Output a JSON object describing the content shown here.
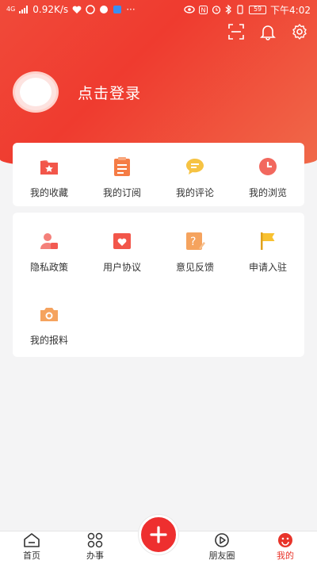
{
  "status_bar": {
    "network_label": "4G",
    "speed": "0.92K/s",
    "more": "···",
    "battery": "59",
    "time": "下午4:02"
  },
  "header": {
    "login_text": "点击登录"
  },
  "card1": {
    "items": [
      {
        "label": "我的收藏",
        "icon": "folder-star-icon"
      },
      {
        "label": "我的订阅",
        "icon": "clipboard-icon"
      },
      {
        "label": "我的评论",
        "icon": "comment-icon"
      },
      {
        "label": "我的浏览",
        "icon": "clock-icon"
      }
    ]
  },
  "card2": {
    "items": [
      {
        "label": "隐私政策",
        "icon": "privacy-user-icon"
      },
      {
        "label": "用户协议",
        "icon": "agreement-heart-icon"
      },
      {
        "label": "意见反馈",
        "icon": "feedback-question-icon"
      },
      {
        "label": "申请入驻",
        "icon": "flag-icon"
      },
      {
        "label": "我的报料",
        "icon": "camera-icon"
      }
    ]
  },
  "tabbar": {
    "tabs": [
      {
        "label": "首页",
        "icon": "home-icon"
      },
      {
        "label": "办事",
        "icon": "grid-icon"
      },
      {
        "label": "",
        "icon": "plus-icon"
      },
      {
        "label": "朋友圈",
        "icon": "friends-icon"
      },
      {
        "label": "我的",
        "icon": "profile-smile-icon",
        "active": true
      }
    ]
  },
  "colors": {
    "brand_red": "#ef3b2f",
    "active_tab": "#e8342a"
  }
}
